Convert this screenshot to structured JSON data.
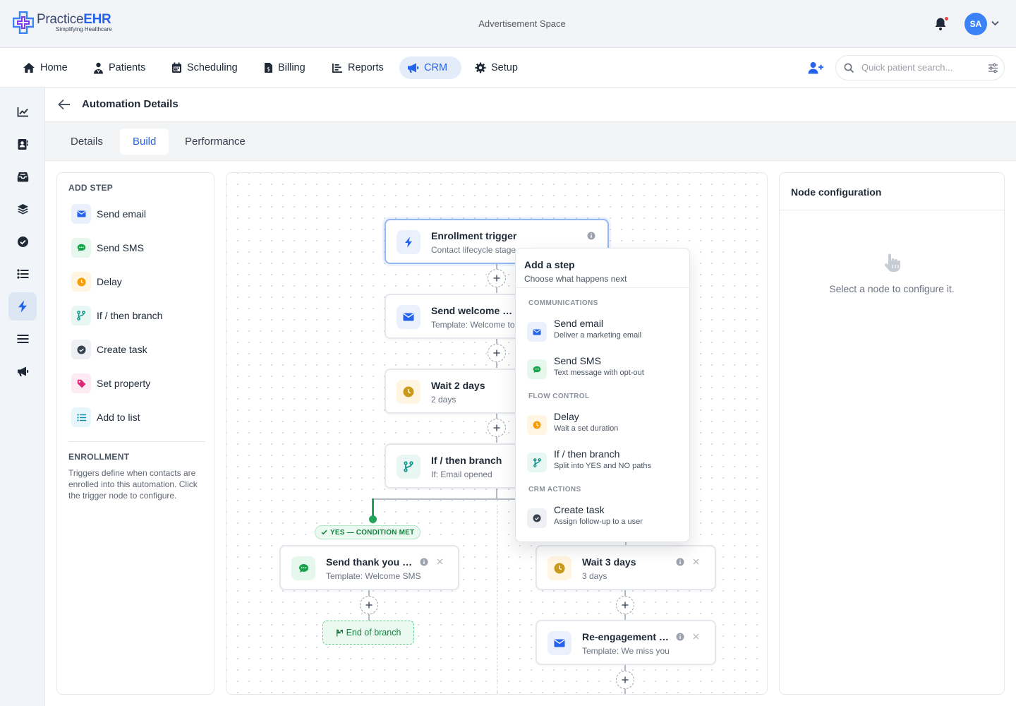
{
  "header": {
    "logo_main": "Practice",
    "logo_accent": "EHR",
    "logo_tagline": "Simplifying Healthcare",
    "ad_space": "Advertisement Space",
    "avatar_initials": "SA"
  },
  "nav": {
    "items": [
      {
        "label": "Home",
        "icon": "home-icon"
      },
      {
        "label": "Patients",
        "icon": "patients-icon"
      },
      {
        "label": "Scheduling",
        "icon": "calendar-icon"
      },
      {
        "label": "Billing",
        "icon": "billing-icon"
      },
      {
        "label": "Reports",
        "icon": "reports-icon"
      },
      {
        "label": "CRM",
        "icon": "megaphone-icon",
        "active": true
      },
      {
        "label": "Setup",
        "icon": "gear-icon"
      }
    ],
    "search_placeholder": "Quick patient search..."
  },
  "sidebar": {
    "icons": [
      "chart-line-icon",
      "contact-book-icon",
      "inbox-icon",
      "layers-icon",
      "check-circle-icon",
      "list-icon",
      "bolt-icon",
      "menu-icon",
      "megaphone-icon"
    ],
    "active_index": 6
  },
  "page": {
    "title": "Automation Details",
    "tabs": [
      "Details",
      "Build",
      "Performance"
    ],
    "active_tab": "Build"
  },
  "add_step": {
    "heading": "ADD STEP",
    "steps": [
      {
        "label": "Send email",
        "icon": "envelope-icon"
      },
      {
        "label": "Send SMS",
        "icon": "sms-icon"
      },
      {
        "label": "Delay",
        "icon": "clock-icon"
      },
      {
        "label": "If / then branch",
        "icon": "branch-icon"
      },
      {
        "label": "Create task",
        "icon": "check-circle-icon"
      },
      {
        "label": "Set property",
        "icon": "tag-icon"
      },
      {
        "label": "Add to list",
        "icon": "list-icon"
      }
    ],
    "enrollment_heading": "ENROLLMENT",
    "enrollment_text": "Triggers define when contacts are enrolled into this automation. Click the trigger node to configure."
  },
  "flow": {
    "nodes": {
      "trigger": {
        "title": "Enrollment trigger",
        "subtitle": "Contact lifecycle stage = Lead"
      },
      "welcome": {
        "title": "Send welcome email",
        "subtitle": "Template: Welcome to our practice"
      },
      "wait2": {
        "title": "Wait 2 days",
        "subtitle": "2 days"
      },
      "branch": {
        "title": "If / then branch",
        "subtitle": "If: Email opened"
      },
      "thank": {
        "title": "Send thank you SMS",
        "subtitle": "Template: Welcome SMS"
      },
      "wait3": {
        "title": "Wait 3 days",
        "subtitle": "3 days"
      },
      "reengage": {
        "title": "Re-engagement email",
        "subtitle": "Template: We miss you"
      }
    },
    "yes_label": "YES — CONDITION MET",
    "end_branch": "End of branch"
  },
  "popover": {
    "title": "Add a step",
    "subtitle": "Choose what happens next",
    "sections": {
      "communications": "COMMUNICATIONS",
      "flow_control": "FLOW CONTROL",
      "crm_actions": "CRM ACTIONS"
    },
    "items": {
      "send_email": {
        "title": "Send email",
        "desc": "Deliver a marketing email"
      },
      "send_sms": {
        "title": "Send SMS",
        "desc": "Text message with opt-out"
      },
      "delay": {
        "title": "Delay",
        "desc": "Wait a set duration"
      },
      "branch": {
        "title": "If / then branch",
        "desc": "Split into YES and NO paths"
      },
      "create_task": {
        "title": "Create task",
        "desc": "Assign follow-up to a user"
      }
    }
  },
  "config": {
    "title": "Node configuration",
    "empty_text": "Select a node to configure it."
  },
  "colors": {
    "primary": "#2563eb",
    "green": "#16a34a",
    "amber": "#f59e0b",
    "teal": "#0d9488",
    "pink": "#db2777",
    "cyan": "#0891b2",
    "slate": "#374151"
  }
}
